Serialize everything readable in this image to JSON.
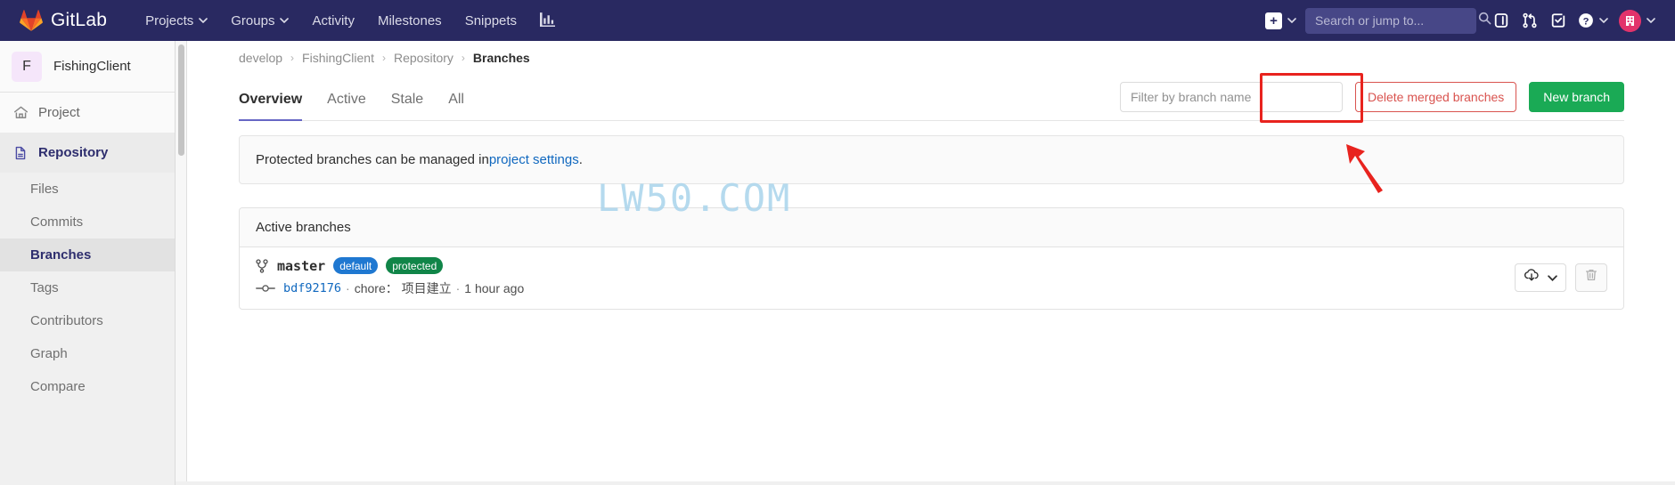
{
  "navbar": {
    "brand": "GitLab",
    "brand_logo_icon": "gitlab-tanuki-logo",
    "items": [
      {
        "label": "Projects",
        "has_caret": true
      },
      {
        "label": "Groups",
        "has_caret": true
      },
      {
        "label": "Activity",
        "has_caret": false
      },
      {
        "label": "Milestones",
        "has_caret": false
      },
      {
        "label": "Snippets",
        "has_caret": false
      }
    ],
    "analytics_icon": "chart-bar-icon",
    "create_new_icon": "plus-square-icon",
    "search": {
      "placeholder": "Search or jump to...",
      "value": "",
      "icon": "search-icon"
    },
    "right_icons": [
      {
        "name": "issues-icon"
      },
      {
        "name": "merge-requests-icon"
      },
      {
        "name": "todos-icon"
      },
      {
        "name": "help-icon"
      }
    ],
    "avatar_icon": "user-avatar"
  },
  "sidebar": {
    "project": {
      "initial": "F",
      "name": "FishingClient"
    },
    "items": [
      {
        "label": "Project",
        "icon": "home-icon",
        "level": "top",
        "active": false
      },
      {
        "label": "Repository",
        "icon": "document-icon",
        "level": "top",
        "active": true
      }
    ],
    "sub_items": [
      {
        "label": "Files",
        "current": false
      },
      {
        "label": "Commits",
        "current": false
      },
      {
        "label": "Branches",
        "current": true
      },
      {
        "label": "Tags",
        "current": false
      },
      {
        "label": "Contributors",
        "current": false
      },
      {
        "label": "Graph",
        "current": false
      },
      {
        "label": "Compare",
        "current": false
      }
    ]
  },
  "breadcrumb": {
    "items": [
      "develop",
      "FishingClient",
      "Repository"
    ],
    "current": "Branches",
    "separator": "›"
  },
  "main": {
    "tabs": [
      {
        "label": "Overview",
        "active": true
      },
      {
        "label": "Active",
        "active": false
      },
      {
        "label": "Stale",
        "active": false
      },
      {
        "label": "All",
        "active": false
      }
    ],
    "filter": {
      "placeholder": "Filter by branch name",
      "value": ""
    },
    "delete_merged_label": "Delete merged branches",
    "new_branch_label": "New branch",
    "notice": {
      "text_before": "Protected branches can be managed in ",
      "link": "project settings",
      "text_after": "."
    },
    "panel_title": "Active branches",
    "branches": [
      {
        "name": "master",
        "branch_icon": "branch-icon",
        "badges": [
          {
            "label": "default",
            "type": "default"
          },
          {
            "label": "protected",
            "type": "protected"
          }
        ],
        "commit_icon": "commit-icon",
        "commit_sha": "bdf92176",
        "commit_message": "chore： 项目建立",
        "commit_time": "1 hour ago",
        "separator": "·",
        "actions": [
          {
            "name": "download-dropdown",
            "icon": "cloud-download-icon",
            "caret": true
          },
          {
            "name": "delete-branch",
            "icon": "trash-icon",
            "disabled": true
          }
        ]
      }
    ]
  },
  "watermark": "LW50.COM",
  "annotations": {
    "highlight_target": "new-branch-button",
    "box_color": "#e8231e",
    "arrow_color": "#e8231e"
  },
  "colors": {
    "navbar_bg": "#292961",
    "sidebar_bg": "#f0f0f0",
    "accent_purple": "#6666c4",
    "success_green": "#1aaa55",
    "danger_red": "#d9534f",
    "link_blue": "#1068bf",
    "badge_default_blue": "#1f78d1",
    "badge_protected_green": "#108548",
    "watermark_blue": "#a9d4ec"
  }
}
